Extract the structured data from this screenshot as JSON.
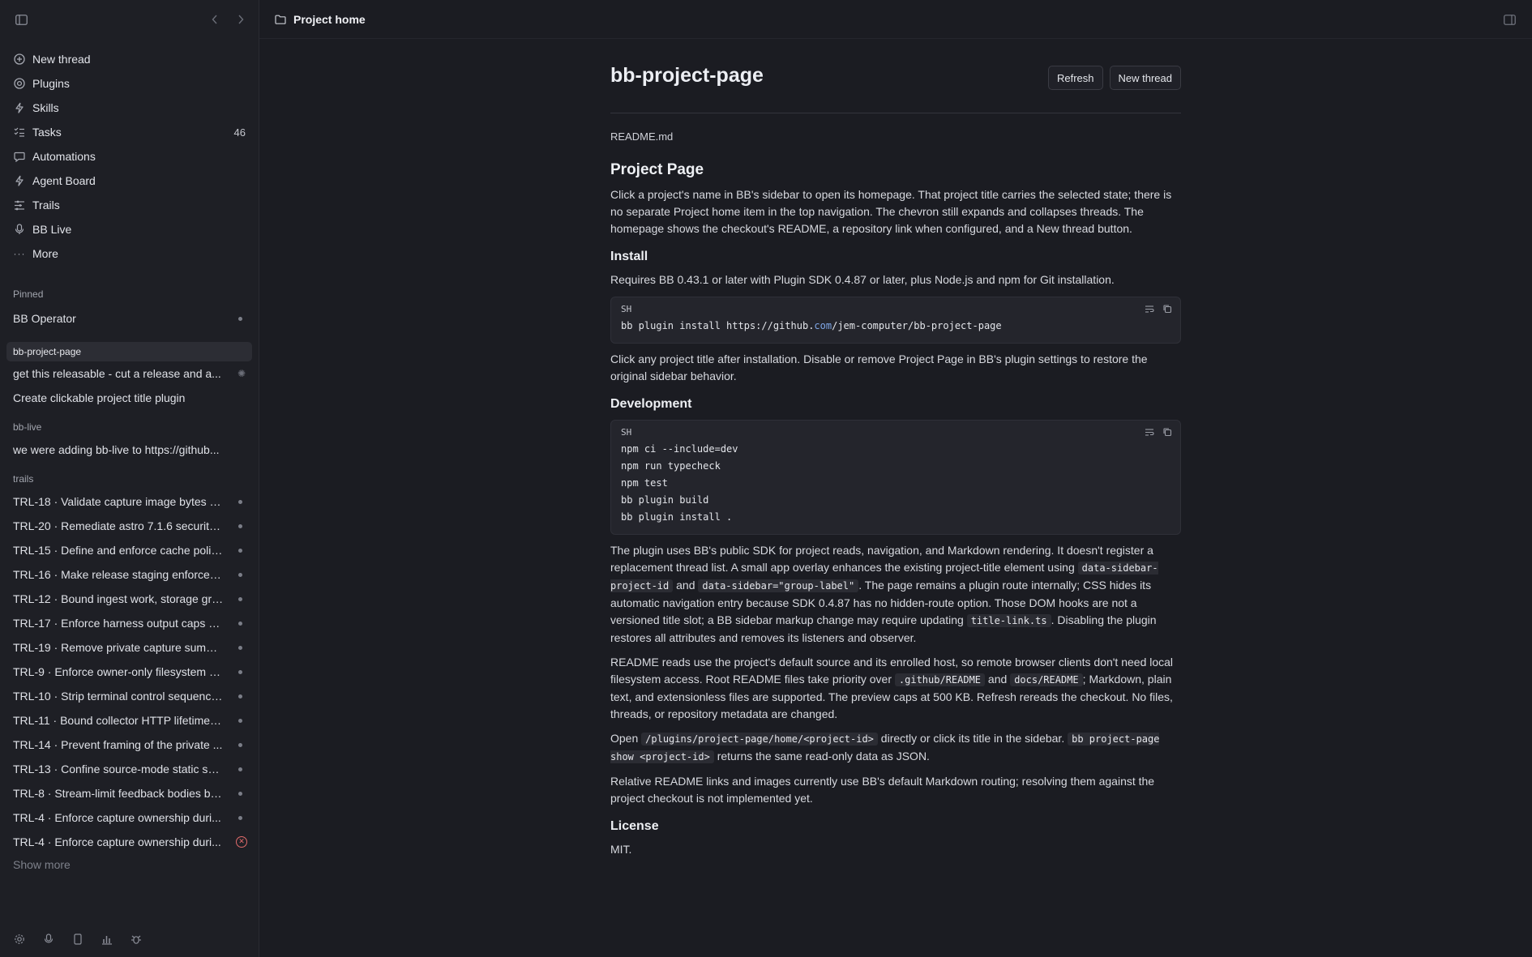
{
  "sidebar": {
    "nav": [
      {
        "label": "New thread",
        "icon": "plus-circle-icon"
      },
      {
        "label": "Plugins",
        "icon": "plugin-icon"
      },
      {
        "label": "Skills",
        "icon": "bolt-icon"
      },
      {
        "label": "Tasks",
        "icon": "tasks-icon",
        "count": "46"
      },
      {
        "label": "Automations",
        "icon": "chat-icon"
      },
      {
        "label": "Agent Board",
        "icon": "bolt-icon"
      },
      {
        "label": "Trails",
        "icon": "trails-icon"
      },
      {
        "label": "BB Live",
        "icon": "mic-icon"
      },
      {
        "label": "More",
        "icon": "more-icon"
      }
    ],
    "pinned": {
      "label": "Pinned",
      "items": [
        {
          "label": "BB Operator"
        }
      ]
    },
    "project_group": {
      "label": "bb-project-page",
      "items": [
        {
          "label": "get this releasable - cut a release and a..."
        },
        {
          "label": "Create clickable project title plugin"
        }
      ]
    },
    "bblive_group": {
      "label": "bb-live",
      "items": [
        {
          "label": "we were adding bb-live to https://github..."
        }
      ]
    },
    "trails_group": {
      "label": "trails",
      "items": [
        {
          "label": "TRL-18 · Validate capture image bytes a..."
        },
        {
          "label": "TRL-20 · Remediate astro 7.1.6 security a..."
        },
        {
          "label": "TRL-15 · Define and enforce cache polic..."
        },
        {
          "label": "TRL-16 · Make release staging enforce b..."
        },
        {
          "label": "TRL-12 · Bound ingest work, storage gro..."
        },
        {
          "label": "TRL-17 · Enforce harness output caps b..."
        },
        {
          "label": "TRL-19 · Remove private capture summa..."
        },
        {
          "label": "TRL-9 · Enforce owner-only filesystem b..."
        },
        {
          "label": "TRL-10 · Strip terminal control sequence..."
        },
        {
          "label": "TRL-11 · Bound collector HTTP lifetimes ..."
        },
        {
          "label": "TRL-14 · Prevent framing of the private ..."
        },
        {
          "label": "TRL-13 · Confine source-mode static ser..."
        },
        {
          "label": "TRL-8 · Stream-limit feedback bodies be..."
        },
        {
          "label": "TRL-4 · Enforce capture ownership duri..."
        },
        {
          "label": "TRL-4 · Enforce capture ownership duri..."
        }
      ],
      "show_more": "Show more"
    }
  },
  "topbar": {
    "breadcrumb": "Project home"
  },
  "page": {
    "title": "bb-project-page",
    "refresh_label": "Refresh",
    "new_thread_label": "New thread",
    "readme_filename": "README.md"
  },
  "readme": {
    "h1": "Project Page",
    "intro": "Click a project's name in BB's sidebar to open its homepage. That project title carries the selected state; there is no separate Project home item in the top navigation. The chevron still expands and collapses threads. The homepage shows the checkout's README, a repository link when configured, and a New thread button.",
    "install_heading": "Install",
    "install_req": "Requires BB 0.43.1 or later with Plugin SDK 0.4.87 or later, plus Node.js and npm for Git installation.",
    "install_code": {
      "lang": "SH",
      "pre": "bb plugin install https://github.",
      "hl": "com",
      "post": "/jem-computer/bb-project-page"
    },
    "install_after": "Click any project title after installation. Disable or remove Project Page in BB's plugin settings to restore the original sidebar behavior.",
    "dev_heading": "Development",
    "dev_code": {
      "lang": "SH",
      "lines": [
        "npm ci --include=dev",
        "npm run typecheck",
        "npm test",
        "bb plugin build",
        "bb plugin install ."
      ]
    },
    "p1": {
      "a": "The plugin uses BB's public SDK for project reads, navigation, and Markdown rendering. It doesn't register a replacement thread list. A small app overlay enhances the existing project-title element using ",
      "c1": "data-sidebar-project-id",
      "b": " and ",
      "c2": "data-sidebar=\"group-label\"",
      "c": ". The page remains a plugin route internally; CSS hides its automatic navigation entry because SDK 0.4.87 has no hidden-route option. Those DOM hooks are not a versioned title slot; a BB sidebar markup change may require updating ",
      "c3": "title-link.ts",
      "d": ". Disabling the plugin restores all attributes and removes its listeners and observer."
    },
    "p2": {
      "a": "README reads use the project's default source and its enrolled host, so remote browser clients don't need local filesystem access. Root README files take priority over ",
      "c1": ".github/README",
      "b": " and ",
      "c2": "docs/README",
      "c": "; Markdown, plain text, and extensionless files are supported. The preview caps at 500 KB. Refresh rereads the checkout. No files, threads, or repository metadata are changed."
    },
    "p3": {
      "a": "Open ",
      "c1": "/plugins/project-page/home/<project-id>",
      "b": " directly or click its title in the sidebar. ",
      "c2": "bb project-page show <project-id>",
      "c": " returns the same read-only data as JSON."
    },
    "p4": "Relative README links and images currently use BB's default Markdown routing; resolving them against the project checkout is not implemented yet.",
    "license_heading": "License",
    "license_text": "MIT."
  }
}
